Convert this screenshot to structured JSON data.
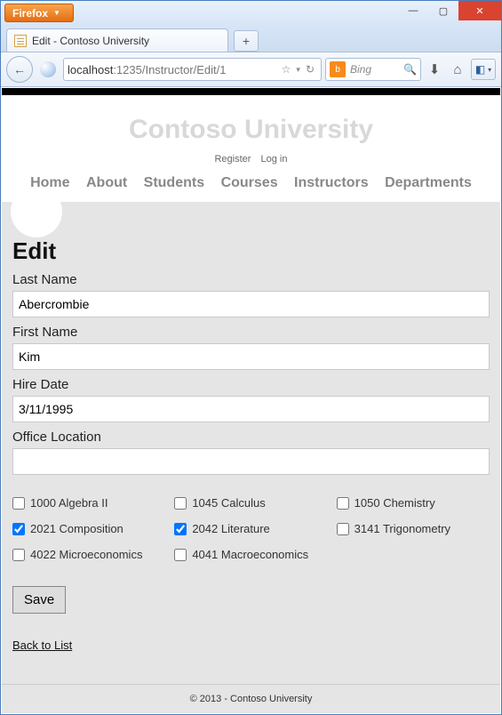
{
  "browser": {
    "button_label": "Firefox",
    "tab_title": "Edit - Contoso University",
    "url_host": "localhost",
    "url_path": ":1235/Instructor/Edit/1",
    "search_placeholder": "Bing"
  },
  "site": {
    "title": "Contoso University",
    "account_links": [
      "Register",
      "Log in"
    ],
    "nav_links": [
      "Home",
      "About",
      "Students",
      "Courses",
      "Instructors",
      "Departments"
    ]
  },
  "page": {
    "heading": "Edit",
    "fields": {
      "last_name": {
        "label": "Last Name",
        "value": "Abercrombie"
      },
      "first_name": {
        "label": "First Name",
        "value": "Kim"
      },
      "hire_date": {
        "label": "Hire Date",
        "value": "3/11/1995"
      },
      "office_location": {
        "label": "Office Location",
        "value": ""
      }
    },
    "courses": [
      {
        "id": "1000",
        "title": "Algebra II",
        "checked": false
      },
      {
        "id": "1045",
        "title": "Calculus",
        "checked": false
      },
      {
        "id": "1050",
        "title": "Chemistry",
        "checked": false
      },
      {
        "id": "2021",
        "title": "Composition",
        "checked": true
      },
      {
        "id": "2042",
        "title": "Literature",
        "checked": true
      },
      {
        "id": "3141",
        "title": "Trigonometry",
        "checked": false
      },
      {
        "id": "4022",
        "title": "Microeconomics",
        "checked": false
      },
      {
        "id": "4041",
        "title": "Macroeconomics",
        "checked": false
      }
    ],
    "save_label": "Save",
    "back_label": "Back to List"
  },
  "footer": "© 2013 - Contoso University"
}
